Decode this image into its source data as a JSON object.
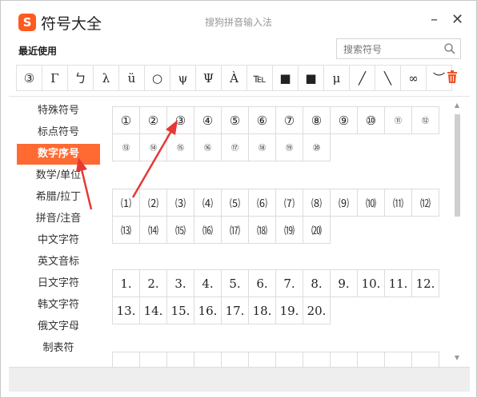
{
  "title": "符号大全",
  "logo_letter": "S",
  "subtitle": "搜狗拼音输入法",
  "window_buttons": {
    "minimize": "–",
    "close": "✕"
  },
  "recent_label": "最近使用",
  "search": {
    "placeholder": "搜索符号"
  },
  "recent_symbols": [
    "③",
    "Γ",
    "ㄅ",
    "λ",
    "ü",
    "○",
    "ψ",
    "Ψ",
    "À",
    "℡",
    "■",
    "■",
    "μ",
    "╱",
    "╲",
    "∞",
    "︶"
  ],
  "sidebar": {
    "items": [
      {
        "label": "特殊符号"
      },
      {
        "label": "标点符号"
      },
      {
        "label": "数字序号"
      },
      {
        "label": "数学/单位"
      },
      {
        "label": "希腊/拉丁"
      },
      {
        "label": "拼音/注音"
      },
      {
        "label": "中文字符"
      },
      {
        "label": "英文音标"
      },
      {
        "label": "日文字符"
      },
      {
        "label": "韩文字符"
      },
      {
        "label": "俄文字母"
      },
      {
        "label": "制表符"
      }
    ],
    "active_index": 2
  },
  "sections": [
    {
      "rows": [
        [
          "①",
          "②",
          "③",
          "④",
          "⑤",
          "⑥",
          "⑦",
          "⑧",
          "⑨",
          "⑩",
          "⑪",
          "⑫"
        ],
        [
          "⑬",
          "⑭",
          "⑮",
          "⑯",
          "⑰",
          "⑱",
          "⑲",
          "⑳"
        ]
      ]
    },
    {
      "rows": [
        [
          "⑴",
          "⑵",
          "⑶",
          "⑷",
          "⑸",
          "⑹",
          "⑺",
          "⑻",
          "⑼",
          "⑽",
          "⑾",
          "⑿"
        ],
        [
          "⒀",
          "⒁",
          "⒂",
          "⒃",
          "⒄",
          "⒅",
          "⒆",
          "⒇"
        ]
      ]
    },
    {
      "rows": [
        [
          "1.",
          "2.",
          "3.",
          "4.",
          "5.",
          "6.",
          "7.",
          "8.",
          "9.",
          "10.",
          "11.",
          "12."
        ],
        [
          "13.",
          "14.",
          "15.",
          "16.",
          "17.",
          "18.",
          "19.",
          "20."
        ]
      ]
    }
  ],
  "colors": {
    "accent": "#ff6a33",
    "annotation_arrow": "#e53935"
  }
}
